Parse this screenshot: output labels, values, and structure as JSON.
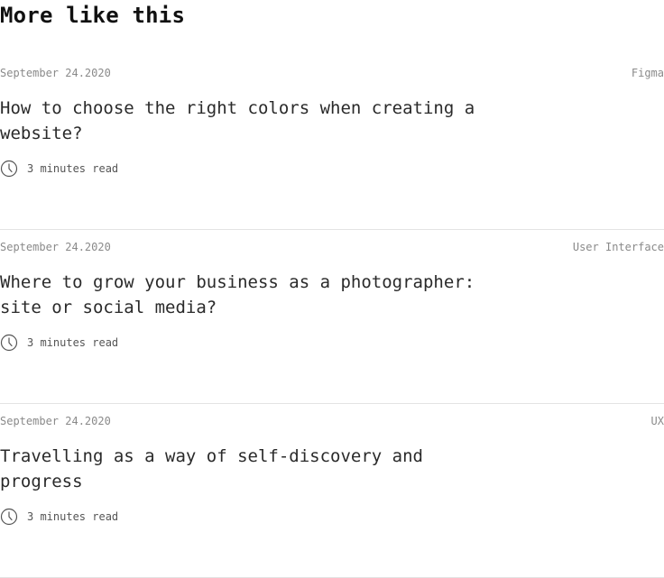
{
  "section": {
    "title": "More like this"
  },
  "articles": [
    {
      "date": "September 24.2020",
      "tag": "Figma",
      "title": "How to choose the right colors when creating a website?",
      "read_time": "3 minutes read",
      "icon": "clock-icon"
    },
    {
      "date": "September 24.2020",
      "tag": "User Interface",
      "title": "Where to grow your business as a photographer: site or social media?",
      "read_time": "3 minutes read",
      "icon": "clock-icon"
    },
    {
      "date": "September 24.2020",
      "tag": "UX",
      "title": "Travelling as a way of self-discovery and progress",
      "read_time": "3 minutes read",
      "icon": "clock-icon"
    }
  ]
}
